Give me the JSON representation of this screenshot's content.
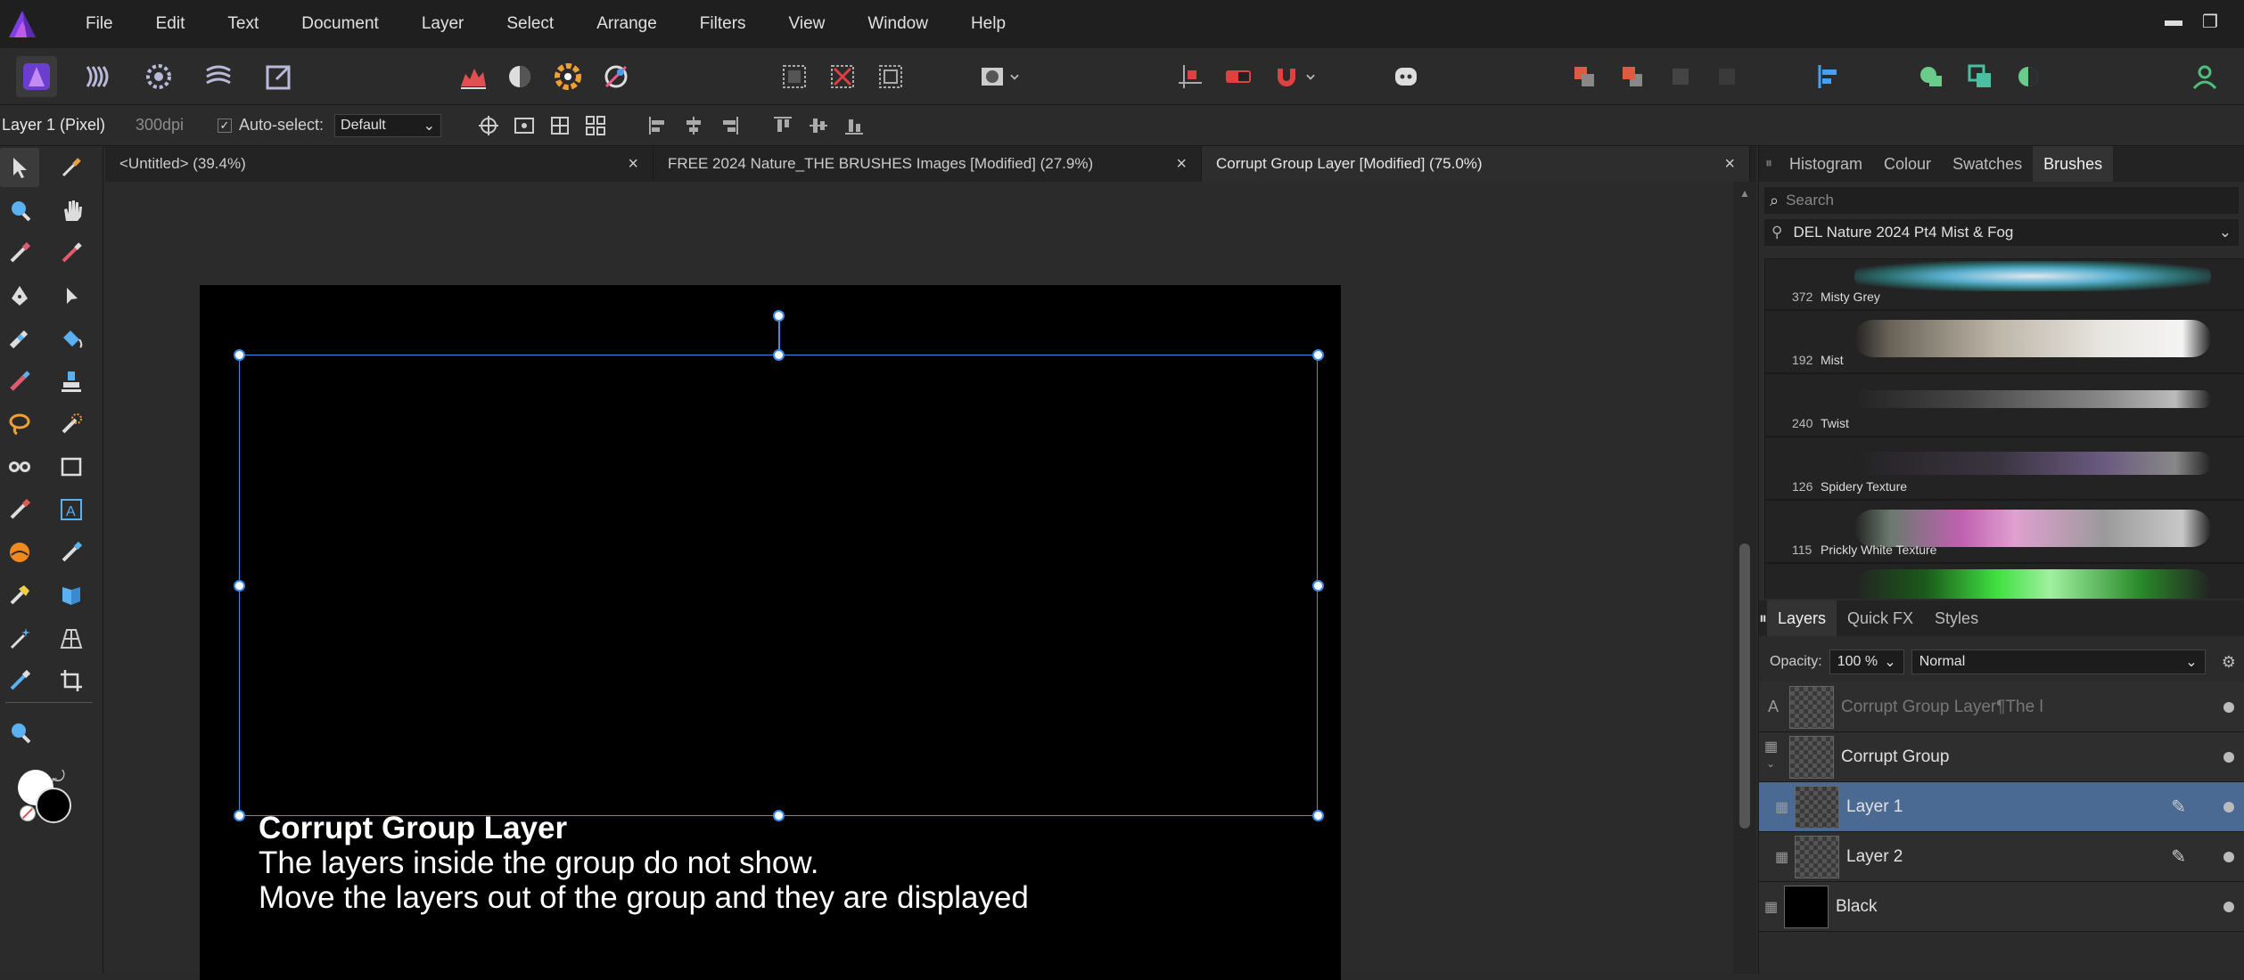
{
  "menu": [
    "File",
    "Edit",
    "Text",
    "Document",
    "Layer",
    "Select",
    "Arrange",
    "Filters",
    "View",
    "Window",
    "Help"
  ],
  "context": {
    "layer": "Layer 1 (Pixel)",
    "dpi": "300dpi",
    "autoselect_label": "Auto-select:",
    "autoselect_value": "Default"
  },
  "tabs": [
    {
      "title": "<Untitled> (39.4%)"
    },
    {
      "title": "FREE 2024 Nature_THE BRUSHES Images [Modified] (27.9%)"
    },
    {
      "title": "Corrupt Group Layer [Modified] (75.0%)"
    }
  ],
  "canvas_text": {
    "heading": "Corrupt Group Layer",
    "line1": "The layers inside the group do not show.",
    "line2": "Move the layers out of the group and they are displayed"
  },
  "studio_tabs": [
    "Histogram",
    "Colour",
    "Swatches",
    "Brushes"
  ],
  "brushes": {
    "search_placeholder": "Search",
    "category": "DEL Nature 2024 Pt4 Mist & Fog",
    "items": [
      {
        "num": "372",
        "name": "Misty Grey"
      },
      {
        "num": "192",
        "name": "Mist"
      },
      {
        "num": "240",
        "name": "Twist"
      },
      {
        "num": "126",
        "name": "Spidery Texture"
      },
      {
        "num": "115",
        "name": "Prickly White Texture"
      }
    ]
  },
  "layer_tabs": [
    "Layers",
    "Quick FX",
    "Styles"
  ],
  "layers_panel": {
    "opacity_label": "Opacity:",
    "opacity_value": "100 %",
    "blend_mode": "Normal",
    "items": [
      {
        "name": "Corrupt Group Layer¶The l"
      },
      {
        "name": "Corrupt Group"
      },
      {
        "name": "Layer 1"
      },
      {
        "name": "Layer 2"
      },
      {
        "name": "Black"
      }
    ]
  },
  "colors": {
    "accent": "#3d8ee8",
    "selected_layer": "#4a6a94",
    "logo": "#8f5ad9"
  }
}
